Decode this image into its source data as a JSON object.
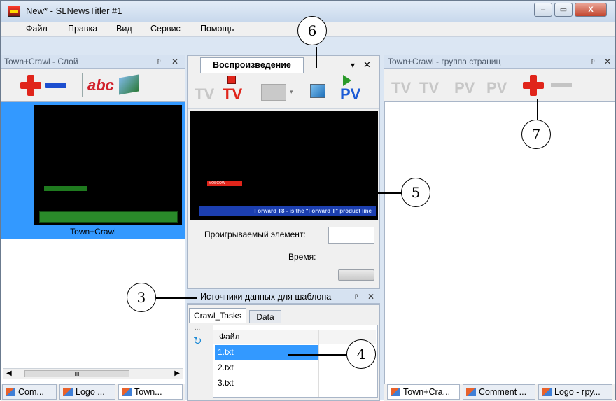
{
  "window": {
    "title": "New* - SLNewsTitler #1",
    "controls": {
      "minimize": "–",
      "maximize": "▭",
      "close": "X"
    }
  },
  "menu": [
    "Файл",
    "Правка",
    "Вид",
    "Сервис",
    "Помощь"
  ],
  "layer_panel": {
    "title": "Town+Crawl - Слой",
    "pin": "ᵖ",
    "close": "✕",
    "toolbar": {
      "add": "+",
      "remove": "—",
      "text_tool": "abc"
    },
    "item_label": "Town+Crawl",
    "scroll_mark": "III"
  },
  "playback_panel": {
    "tab_label": "Воспроизведение",
    "menu_glyph": "▾",
    "close": "✕",
    "buttons": [
      "TV",
      "TV",
      "PV"
    ],
    "ticker_text": "Forward T8 - is the \"Forward T\" product line",
    "red_tag_text": "MOSCOW",
    "playing_element_label": "Проигрываемый элемент:",
    "time_label": "Время:"
  },
  "datasources_panel": {
    "title": "Источники данных для шаблона",
    "pin": "ᵖ",
    "close": "✕",
    "tabs": [
      "Crawl_Tasks",
      "Data"
    ],
    "column_header": "Файл",
    "rows": [
      "1.txt",
      "2.txt",
      "3.txt"
    ],
    "ellipsis": "..."
  },
  "pages_panel": {
    "title": "Town+Crawl - группа страниц",
    "pin": "ᵖ",
    "close": "✕",
    "buttons": [
      "TV",
      "TV",
      "PV",
      "PV"
    ]
  },
  "bottom_tabs_left": [
    "Com...",
    "Logo ...",
    "Town..."
  ],
  "bottom_tabs_right": [
    "Town+Cra...",
    "Comment ...",
    "Logo - гру..."
  ],
  "callouts": [
    "3",
    "4",
    "5",
    "6",
    "7"
  ],
  "colors": {
    "accent": "#3399ff",
    "red": "#e0251b",
    "green": "#1f7a1f",
    "blue": "#1c5bd6"
  }
}
